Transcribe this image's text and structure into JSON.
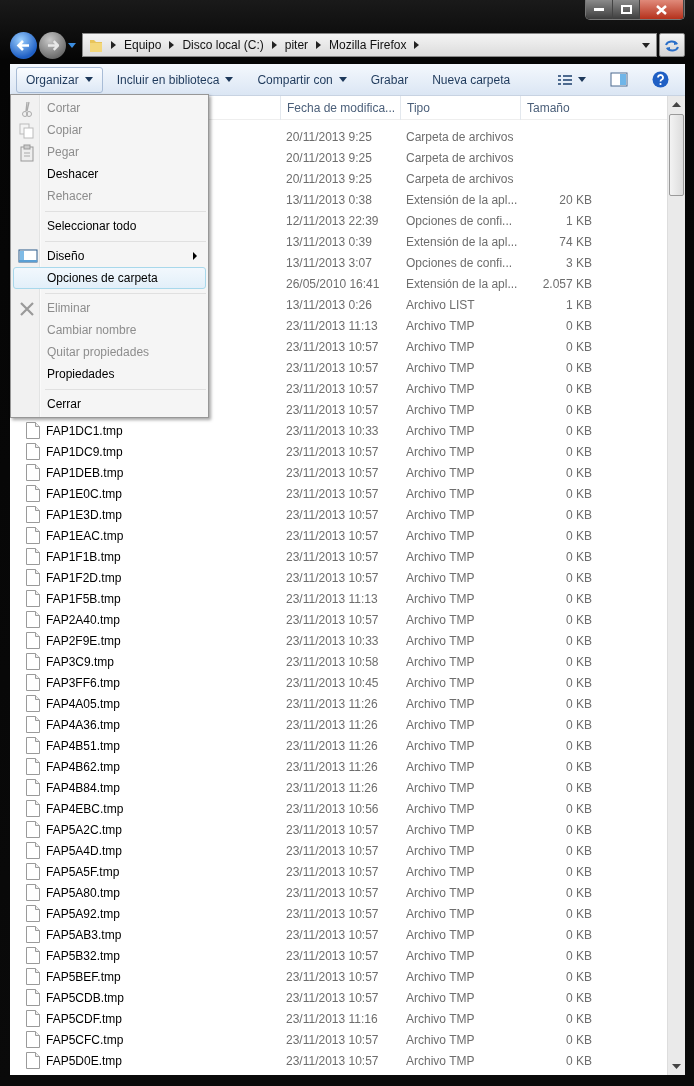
{
  "address_bar": {
    "crumbs": [
      "Equipo",
      "Disco local (C:)",
      "piter",
      "Mozilla Firefox"
    ]
  },
  "toolbar": {
    "buttons": [
      {
        "label": "Organizar",
        "dropdown": true,
        "selected": true
      },
      {
        "label": "Incluir en biblioteca",
        "dropdown": true,
        "selected": false
      },
      {
        "label": "Compartir con",
        "dropdown": true,
        "selected": false
      },
      {
        "label": "Grabar",
        "dropdown": false,
        "selected": false
      },
      {
        "label": "Nueva carpeta",
        "dropdown": false,
        "selected": false
      }
    ]
  },
  "columns": [
    "Fecha de modifica...",
    "Tipo",
    "Tamaño"
  ],
  "rows": [
    {
      "date": "20/11/2013 9:25",
      "type": "Carpeta de archivos"
    },
    {
      "date": "20/11/2013 9:25",
      "type": "Carpeta de archivos"
    },
    {
      "date": "20/11/2013 9:25",
      "type": "Carpeta de archivos"
    },
    {
      "date": "13/11/2013 0:38",
      "type": "Extensión de la apl...",
      "size": "20 KB"
    },
    {
      "date": "12/11/2013 22:39",
      "type": "Opciones de confi...",
      "size": "1 KB"
    },
    {
      "date": "13/11/2013 0:39",
      "type": "Extensión de la apl...",
      "size": "74 KB"
    },
    {
      "date": "13/11/2013 3:07",
      "type": "Opciones de confi...",
      "size": "3 KB"
    },
    {
      "date": "26/05/2010 16:41",
      "type": "Extensión de la apl...",
      "size": "2.057 KB"
    },
    {
      "date": "13/11/2013 0:26",
      "type": "Archivo LIST",
      "size": "1 KB"
    },
    {
      "date": "23/11/2013 11:13",
      "type": "Archivo TMP",
      "size": "0 KB"
    },
    {
      "date": "23/11/2013 10:57",
      "type": "Archivo TMP",
      "size": "0 KB"
    },
    {
      "date": "23/11/2013 10:57",
      "type": "Archivo TMP",
      "size": "0 KB"
    },
    {
      "date": "23/11/2013 10:57",
      "type": "Archivo TMP",
      "size": "0 KB"
    },
    {
      "date": "23/11/2013 10:57",
      "type": "Archivo TMP",
      "size": "0 KB"
    },
    {
      "name": "FAP1DC1.tmp",
      "date": "23/11/2013 10:33",
      "type": "Archivo TMP",
      "size": "0 KB"
    },
    {
      "name": "FAP1DC9.tmp",
      "date": "23/11/2013 10:57",
      "type": "Archivo TMP",
      "size": "0 KB"
    },
    {
      "name": "FAP1DEB.tmp",
      "date": "23/11/2013 10:57",
      "type": "Archivo TMP",
      "size": "0 KB"
    },
    {
      "name": "FAP1E0C.tmp",
      "date": "23/11/2013 10:57",
      "type": "Archivo TMP",
      "size": "0 KB"
    },
    {
      "name": "FAP1E3D.tmp",
      "date": "23/11/2013 10:57",
      "type": "Archivo TMP",
      "size": "0 KB"
    },
    {
      "name": "FAP1EAC.tmp",
      "date": "23/11/2013 10:57",
      "type": "Archivo TMP",
      "size": "0 KB"
    },
    {
      "name": "FAP1F1B.tmp",
      "date": "23/11/2013 10:57",
      "type": "Archivo TMP",
      "size": "0 KB"
    },
    {
      "name": "FAP1F2D.tmp",
      "date": "23/11/2013 10:57",
      "type": "Archivo TMP",
      "size": "0 KB"
    },
    {
      "name": "FAP1F5B.tmp",
      "date": "23/11/2013 11:13",
      "type": "Archivo TMP",
      "size": "0 KB"
    },
    {
      "name": "FAP2A40.tmp",
      "date": "23/11/2013 10:57",
      "type": "Archivo TMP",
      "size": "0 KB"
    },
    {
      "name": "FAP2F9E.tmp",
      "date": "23/11/2013 10:33",
      "type": "Archivo TMP",
      "size": "0 KB"
    },
    {
      "name": "FAP3C9.tmp",
      "date": "23/11/2013 10:58",
      "type": "Archivo TMP",
      "size": "0 KB"
    },
    {
      "name": "FAP3FF6.tmp",
      "date": "23/11/2013 10:45",
      "type": "Archivo TMP",
      "size": "0 KB"
    },
    {
      "name": "FAP4A05.tmp",
      "date": "23/11/2013 11:26",
      "type": "Archivo TMP",
      "size": "0 KB"
    },
    {
      "name": "FAP4A36.tmp",
      "date": "23/11/2013 11:26",
      "type": "Archivo TMP",
      "size": "0 KB"
    },
    {
      "name": "FAP4B51.tmp",
      "date": "23/11/2013 11:26",
      "type": "Archivo TMP",
      "size": "0 KB"
    },
    {
      "name": "FAP4B62.tmp",
      "date": "23/11/2013 11:26",
      "type": "Archivo TMP",
      "size": "0 KB"
    },
    {
      "name": "FAP4B84.tmp",
      "date": "23/11/2013 11:26",
      "type": "Archivo TMP",
      "size": "0 KB"
    },
    {
      "name": "FAP4EBC.tmp",
      "date": "23/11/2013 10:56",
      "type": "Archivo TMP",
      "size": "0 KB"
    },
    {
      "name": "FAP5A2C.tmp",
      "date": "23/11/2013 10:57",
      "type": "Archivo TMP",
      "size": "0 KB"
    },
    {
      "name": "FAP5A4D.tmp",
      "date": "23/11/2013 10:57",
      "type": "Archivo TMP",
      "size": "0 KB"
    },
    {
      "name": "FAP5A5F.tmp",
      "date": "23/11/2013 10:57",
      "type": "Archivo TMP",
      "size": "0 KB"
    },
    {
      "name": "FAP5A80.tmp",
      "date": "23/11/2013 10:57",
      "type": "Archivo TMP",
      "size": "0 KB"
    },
    {
      "name": "FAP5A92.tmp",
      "date": "23/11/2013 10:57",
      "type": "Archivo TMP",
      "size": "0 KB"
    },
    {
      "name": "FAP5AB3.tmp",
      "date": "23/11/2013 10:57",
      "type": "Archivo TMP",
      "size": "0 KB"
    },
    {
      "name": "FAP5B32.tmp",
      "date": "23/11/2013 10:57",
      "type": "Archivo TMP",
      "size": "0 KB"
    },
    {
      "name": "FAP5BEF.tmp",
      "date": "23/11/2013 10:57",
      "type": "Archivo TMP",
      "size": "0 KB"
    },
    {
      "name": "FAP5CDB.tmp",
      "date": "23/11/2013 10:57",
      "type": "Archivo TMP",
      "size": "0 KB"
    },
    {
      "name": "FAP5CDF.tmp",
      "date": "23/11/2013 11:16",
      "type": "Archivo TMP",
      "size": "0 KB"
    },
    {
      "name": "FAP5CFC.tmp",
      "date": "23/11/2013 10:57",
      "type": "Archivo TMP",
      "size": "0 KB"
    },
    {
      "name": "FAP5D0E.tmp",
      "date": "23/11/2013 10:57",
      "type": "Archivo TMP",
      "size": "0 KB"
    }
  ],
  "menu": {
    "items": [
      {
        "kind": "item",
        "label": "Cortar",
        "disabled": true,
        "selected": false,
        "submenu": false
      },
      {
        "kind": "item",
        "label": "Copiar",
        "disabled": true,
        "selected": false,
        "submenu": false
      },
      {
        "kind": "item",
        "label": "Pegar",
        "disabled": true,
        "selected": false,
        "submenu": false
      },
      {
        "kind": "item",
        "label": "Deshacer",
        "disabled": false,
        "selected": false,
        "submenu": false
      },
      {
        "kind": "item",
        "label": "Rehacer",
        "disabled": true,
        "selected": false,
        "submenu": false
      },
      {
        "kind": "separator"
      },
      {
        "kind": "item",
        "label": "Seleccionar todo",
        "disabled": false,
        "selected": false,
        "submenu": false
      },
      {
        "kind": "separator"
      },
      {
        "kind": "item",
        "label": "Diseño",
        "disabled": false,
        "selected": false,
        "submenu": true
      },
      {
        "kind": "item",
        "label": "Opciones de carpeta",
        "disabled": false,
        "selected": true,
        "submenu": false
      },
      {
        "kind": "separator"
      },
      {
        "kind": "item",
        "label": "Eliminar",
        "disabled": true,
        "selected": false,
        "submenu": false
      },
      {
        "kind": "item",
        "label": "Cambiar nombre",
        "disabled": true,
        "selected": false,
        "submenu": false
      },
      {
        "kind": "item",
        "label": "Quitar propiedades",
        "disabled": true,
        "selected": false,
        "submenu": false
      },
      {
        "kind": "item",
        "label": "Propiedades",
        "disabled": false,
        "selected": false,
        "submenu": false
      },
      {
        "kind": "separator"
      },
      {
        "kind": "item",
        "label": "Cerrar",
        "disabled": false,
        "selected": false,
        "submenu": false
      }
    ]
  }
}
